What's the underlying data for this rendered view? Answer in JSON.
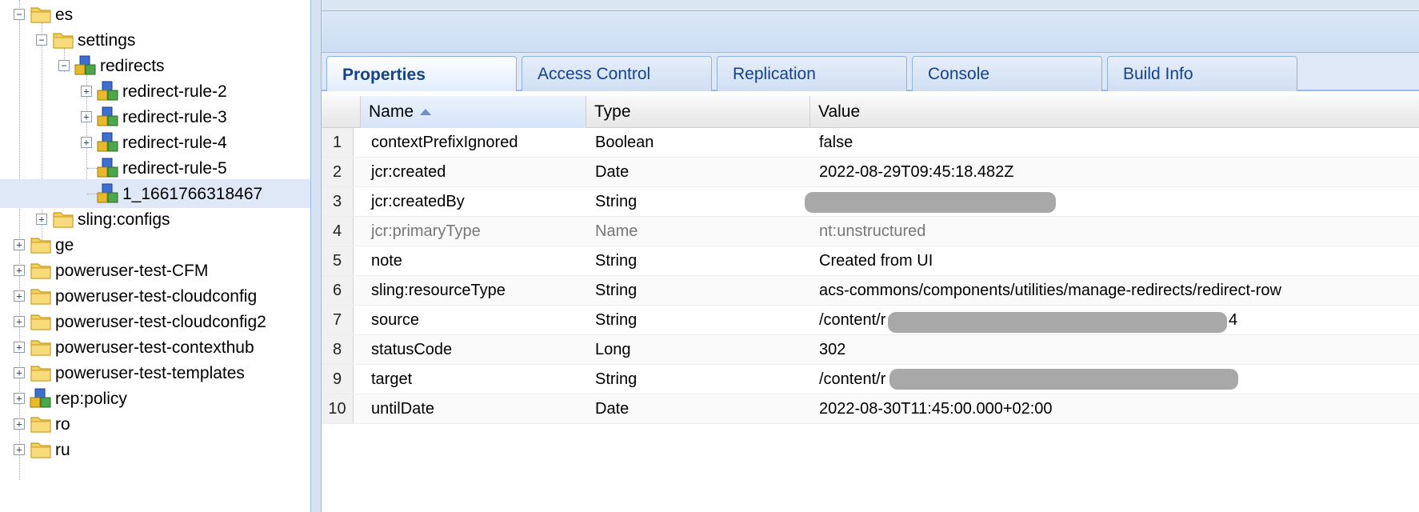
{
  "tree": {
    "nodes": [
      {
        "label": "es",
        "icon": "folder-icon",
        "toggle": "minus"
      },
      {
        "label": "settings",
        "icon": "folder-icon",
        "toggle": "minus"
      },
      {
        "label": "redirects",
        "icon": "node-cubes-icon",
        "toggle": "minus"
      },
      {
        "label": "redirect-rule-2",
        "icon": "node-cubes-icon",
        "toggle": "plus"
      },
      {
        "label": "redirect-rule-3",
        "icon": "node-cubes-icon",
        "toggle": "plus"
      },
      {
        "label": "redirect-rule-4",
        "icon": "node-cubes-icon",
        "toggle": "plus"
      },
      {
        "label": "redirect-rule-5",
        "icon": "node-cubes-icon",
        "toggle": ""
      },
      {
        "label": "1_1661766318467",
        "icon": "node-cubes-icon",
        "toggle": "",
        "selected": true
      },
      {
        "label": "sling:configs",
        "icon": "folder-icon",
        "toggle": "plus"
      },
      {
        "label": "ge",
        "icon": "folder-icon",
        "toggle": "plus"
      },
      {
        "label": "poweruser-test-CFM",
        "icon": "folder-icon",
        "toggle": "plus"
      },
      {
        "label": "poweruser-test-cloudconfig",
        "icon": "folder-icon",
        "toggle": "plus"
      },
      {
        "label": "poweruser-test-cloudconfig2",
        "icon": "folder-icon",
        "toggle": "plus"
      },
      {
        "label": "poweruser-test-contexthub",
        "icon": "folder-icon",
        "toggle": "plus"
      },
      {
        "label": "poweruser-test-templates",
        "icon": "folder-icon",
        "toggle": "plus"
      },
      {
        "label": "rep:policy",
        "icon": "node-cubes-icon",
        "toggle": "plus"
      },
      {
        "label": "ro",
        "icon": "folder-icon",
        "toggle": "plus"
      },
      {
        "label": "ru",
        "icon": "folder-icon",
        "toggle": "plus"
      }
    ]
  },
  "tabs": [
    {
      "label": "Properties",
      "active": true
    },
    {
      "label": "Access Control"
    },
    {
      "label": "Replication"
    },
    {
      "label": "Console"
    },
    {
      "label": "Build Info"
    }
  ],
  "grid": {
    "columns": {
      "name": "Name",
      "type": "Type",
      "value": "Value"
    },
    "sort": "ascending",
    "rows": [
      {
        "num": "1",
        "name": "contextPrefixIgnored",
        "type": "Boolean",
        "value": "false"
      },
      {
        "num": "2",
        "name": "jcr:created",
        "type": "Date",
        "value": "2022-08-29T09:45:18.482Z"
      },
      {
        "num": "3",
        "name": "jcr:createdBy",
        "type": "String",
        "value": "",
        "redacted": true
      },
      {
        "num": "4",
        "name": "jcr:primaryType",
        "type": "Name",
        "value": "nt:unstructured",
        "dim": true
      },
      {
        "num": "5",
        "name": "note",
        "type": "String",
        "value": "Created from UI"
      },
      {
        "num": "6",
        "name": "sling:resourceType",
        "type": "String",
        "value": "acs-commons/components/utilities/manage-redirects/redirect-row"
      },
      {
        "num": "7",
        "name": "source",
        "type": "String",
        "value": "/content/r",
        "value_tail": "4",
        "redacted": true
      },
      {
        "num": "8",
        "name": "statusCode",
        "type": "Long",
        "value": "302"
      },
      {
        "num": "9",
        "name": "target",
        "type": "String",
        "value": "/content/r",
        "redacted": true
      },
      {
        "num": "10",
        "name": "untilDate",
        "type": "Date",
        "value": "2022-08-30T11:45:00.000+02:00"
      }
    ]
  },
  "colors": {
    "selection": "#dfe8f6",
    "tab_text": "#15428b",
    "border": "#99bbe8",
    "redaction": "#a8a8a8"
  }
}
